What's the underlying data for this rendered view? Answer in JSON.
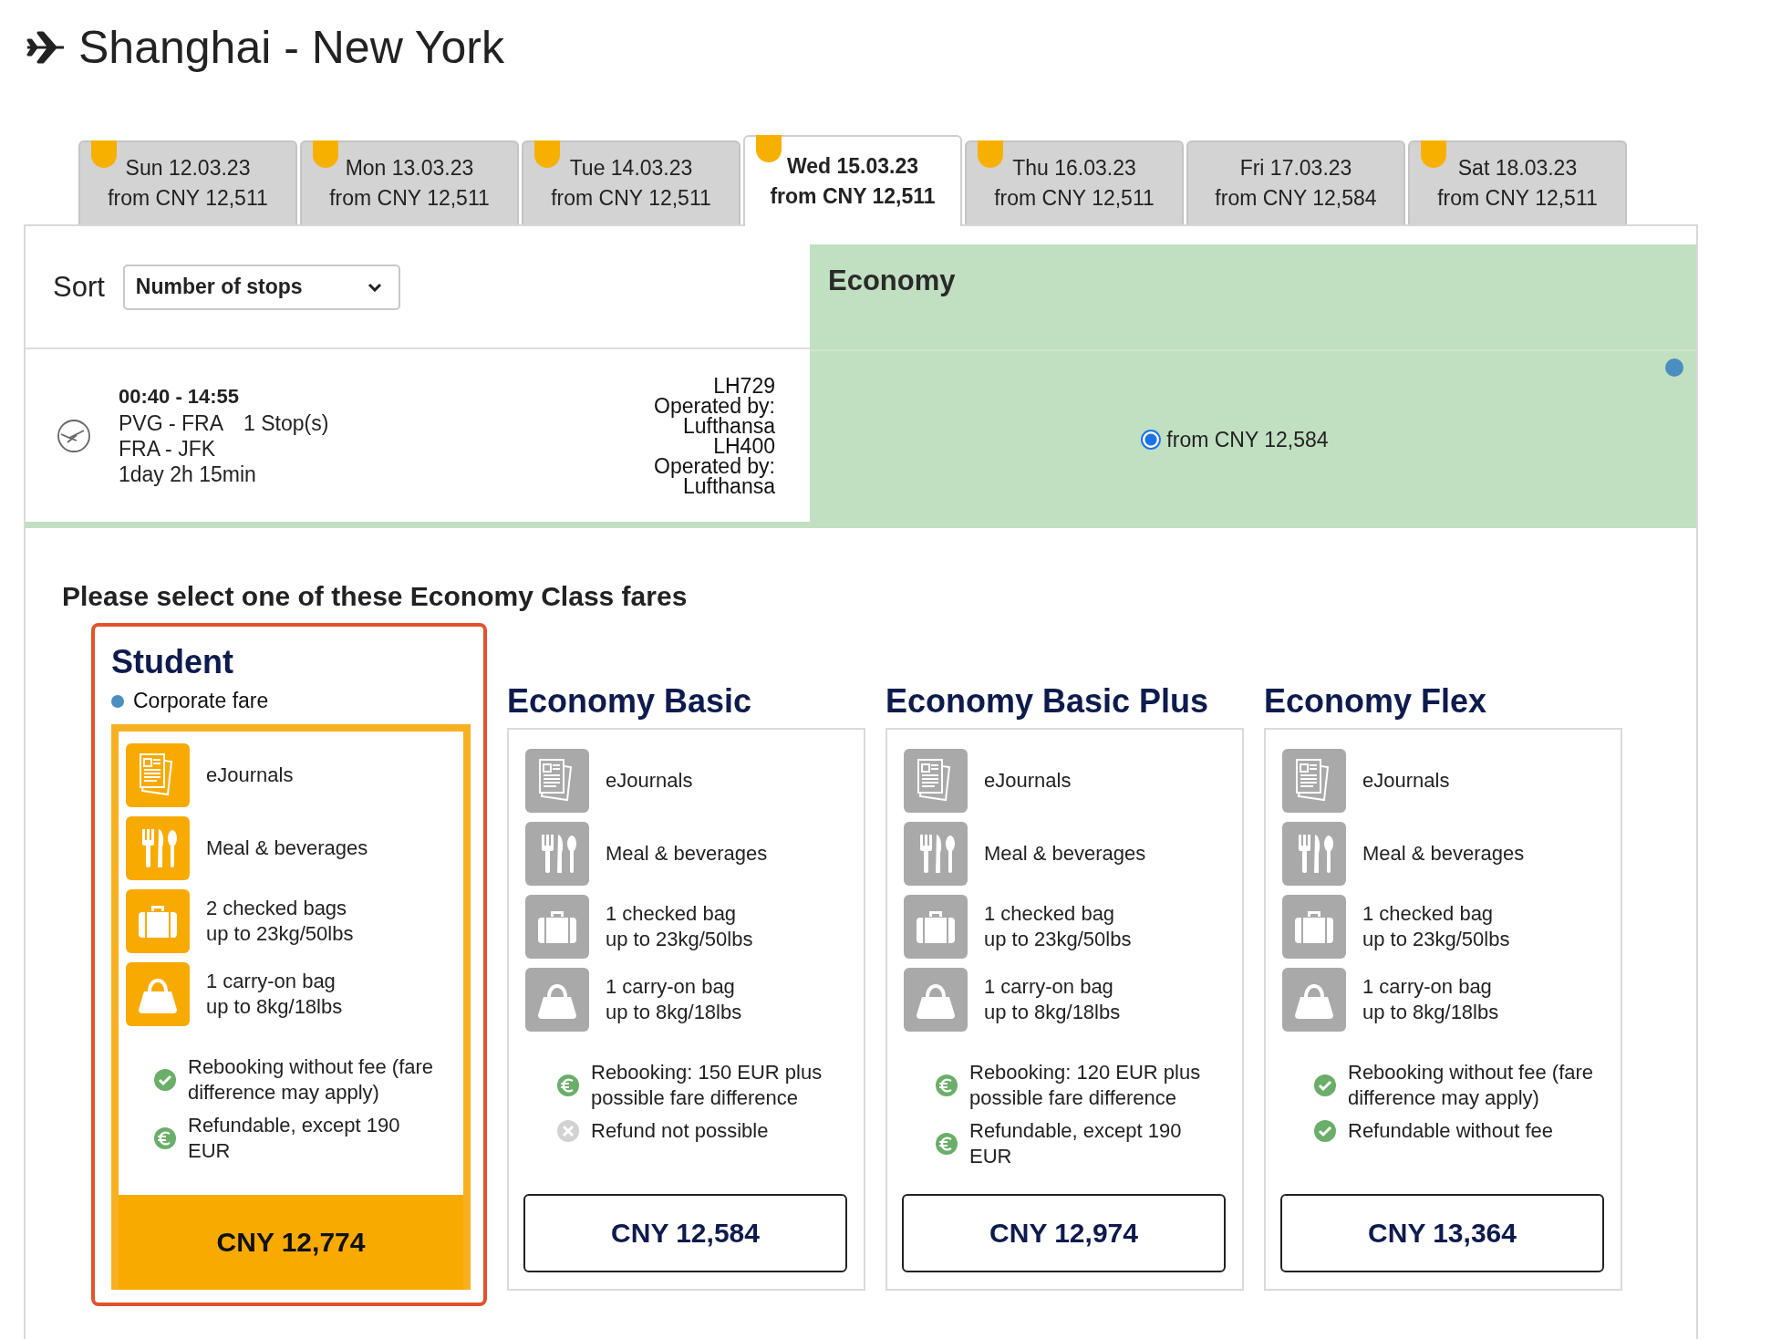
{
  "title": "Shanghai - New York",
  "date_tabs": [
    {
      "day": "Sun 12.03.23",
      "price": "from CNY 12,511",
      "selected": false,
      "marked": true
    },
    {
      "day": "Mon 13.03.23",
      "price": "from CNY 12,511",
      "selected": false,
      "marked": true
    },
    {
      "day": "Tue 14.03.23",
      "price": "from CNY 12,511",
      "selected": false,
      "marked": true
    },
    {
      "day": "Wed 15.03.23",
      "price": "from CNY 12,511",
      "selected": true,
      "marked": true
    },
    {
      "day": "Thu 16.03.23",
      "price": "from CNY 12,511",
      "selected": false,
      "marked": true
    },
    {
      "day": "Fri 17.03.23",
      "price": "from CNY 12,584",
      "selected": false,
      "marked": false
    },
    {
      "day": "Sat 18.03.23",
      "price": "from CNY 12,511",
      "selected": false,
      "marked": true
    }
  ],
  "sort": {
    "label": "Sort",
    "value": "Number of stops"
  },
  "cabin": {
    "label": "Economy"
  },
  "flight": {
    "times": "00:40 - 14:55",
    "first_leg": "PVG - FRA",
    "stops": "1 Stop(s)",
    "second_leg": "FRA - JFK",
    "duration": "1day 2h 15min",
    "carrier_lines": [
      "LH729",
      "Operated by:",
      "Lufthansa",
      "LH400",
      "Operated by:",
      "Lufthansa"
    ],
    "fare_option": {
      "label": "from CNY 12,584",
      "selected": true
    }
  },
  "fares_heading": "Please select one of these Economy Class fares",
  "fares": [
    {
      "name": "Student",
      "selected": true,
      "badge": "Corporate fare",
      "features": [
        {
          "kind": "journal",
          "lines": [
            "eJournals"
          ]
        },
        {
          "kind": "meal",
          "lines": [
            "Meal & beverages"
          ]
        },
        {
          "kind": "suitcase",
          "lines": [
            "2 checked bags",
            "up to 23kg/50lbs"
          ]
        },
        {
          "kind": "handbag",
          "lines": [
            "1 carry-on bag",
            "up to 8kg/18lbs"
          ]
        }
      ],
      "conditions": [
        {
          "kind": "check",
          "text": "Rebooking without fee (fare difference may apply)"
        },
        {
          "kind": "euro",
          "text": "Refundable, except 190 EUR"
        }
      ],
      "price": "CNY 12,774"
    },
    {
      "name": "Economy Basic",
      "selected": false,
      "features": [
        {
          "kind": "journal",
          "lines": [
            "eJournals"
          ]
        },
        {
          "kind": "meal",
          "lines": [
            "Meal & beverages"
          ]
        },
        {
          "kind": "suitcase",
          "lines": [
            "1 checked bag",
            "up to 23kg/50lbs"
          ]
        },
        {
          "kind": "handbag",
          "lines": [
            "1 carry-on bag",
            "up to 8kg/18lbs"
          ]
        }
      ],
      "conditions": [
        {
          "kind": "euro",
          "text": "Rebooking: 150 EUR plus possible fare difference"
        },
        {
          "kind": "cross",
          "text": "Refund not possible"
        }
      ],
      "price": "CNY 12,584"
    },
    {
      "name": "Economy Basic Plus",
      "selected": false,
      "features": [
        {
          "kind": "journal",
          "lines": [
            "eJournals"
          ]
        },
        {
          "kind": "meal",
          "lines": [
            "Meal & beverages"
          ]
        },
        {
          "kind": "suitcase",
          "lines": [
            "1 checked bag",
            "up to 23kg/50lbs"
          ]
        },
        {
          "kind": "handbag",
          "lines": [
            "1 carry-on bag",
            "up to 8kg/18lbs"
          ]
        }
      ],
      "conditions": [
        {
          "kind": "euro",
          "text": "Rebooking: 120 EUR plus possible fare difference"
        },
        {
          "kind": "euro",
          "text": "Refundable, except 190 EUR"
        }
      ],
      "price": "CNY 12,974"
    },
    {
      "name": "Economy Flex",
      "selected": false,
      "features": [
        {
          "kind": "journal",
          "lines": [
            "eJournals"
          ]
        },
        {
          "kind": "meal",
          "lines": [
            "Meal & beverages"
          ]
        },
        {
          "kind": "suitcase",
          "lines": [
            "1 checked bag",
            "up to 23kg/50lbs"
          ]
        },
        {
          "kind": "handbag",
          "lines": [
            "1 carry-on bag",
            "up to 8kg/18lbs"
          ]
        }
      ],
      "conditions": [
        {
          "kind": "check",
          "text": "Rebooking without fee (fare difference may apply)"
        },
        {
          "kind": "check",
          "text": "Refundable without fee"
        }
      ],
      "price": "CNY 13,364"
    }
  ]
}
